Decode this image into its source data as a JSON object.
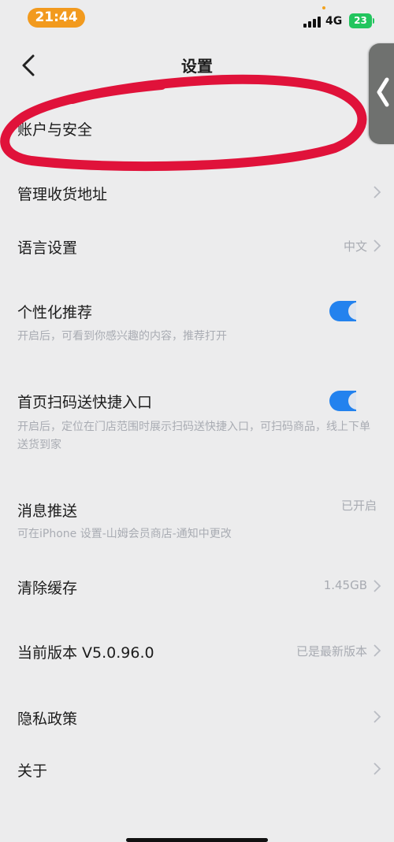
{
  "status_bar": {
    "time": "21:44",
    "network": "4G",
    "battery": "23"
  },
  "nav": {
    "title": "设置",
    "back_icon": "chevron-left-icon"
  },
  "settings": {
    "account_security": {
      "label": "账户与安全"
    },
    "addresses": {
      "label": "管理收货地址"
    },
    "language": {
      "label": "语言设置",
      "value": "中文"
    },
    "personalized": {
      "label": "个性化推荐",
      "subtitle": "开启后，可看到你感兴趣的内容，推荐打开",
      "enabled": true
    },
    "quick_scan": {
      "label": "首页扫码送快捷入口",
      "subtitle": "开启后，定位在门店范围时展示扫码送快捷入口，可扫码商品，线上下单送货到家",
      "enabled": true
    },
    "notifications": {
      "label": "消息推送",
      "value": "已开启",
      "subtitle": "可在iPhone 设置-山姆会员商店-通知中更改"
    },
    "cache": {
      "label": "清除缓存",
      "value": "1.45GB"
    },
    "version": {
      "label": "当前版本 V5.0.96.0",
      "value": "已是最新版本"
    },
    "privacy": {
      "label": "隐私政策"
    },
    "about": {
      "label": "关于"
    }
  },
  "colors": {
    "background": "#ececed",
    "toggle_on": "#2382ee",
    "annotation": "#e0123a",
    "time_pill": "#f29a1e",
    "battery": "#22c55e"
  }
}
